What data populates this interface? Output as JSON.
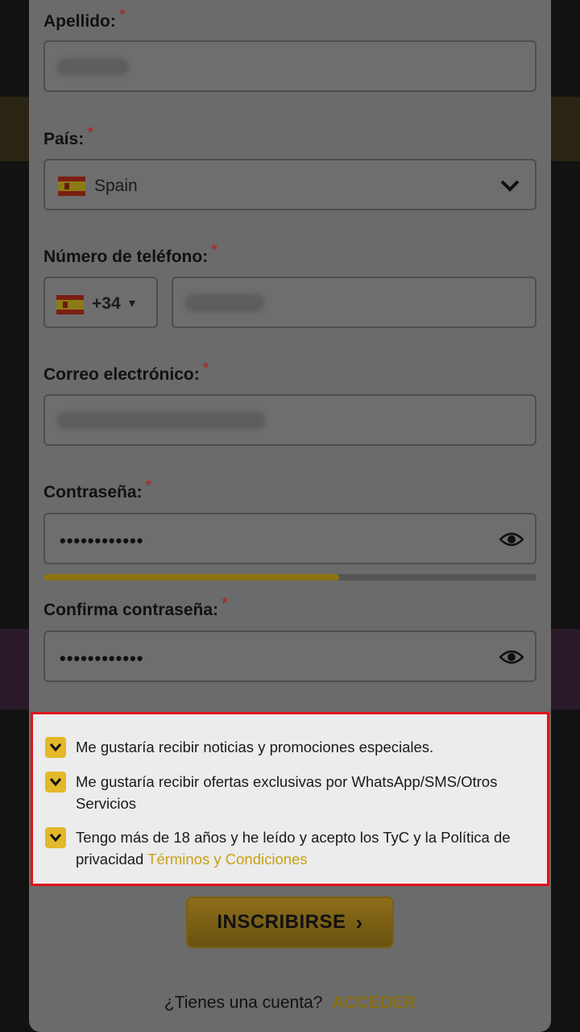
{
  "form": {
    "apellido": {
      "label": "Apellido:",
      "required_mark": "*"
    },
    "pais": {
      "label": "País:",
      "required_mark": "*",
      "value": "Spain",
      "flag_icon": "spain-flag-icon"
    },
    "telefono": {
      "label": "Número de teléfono:",
      "required_mark": "*",
      "prefix": "+34",
      "prefix_caret": "▾"
    },
    "correo": {
      "label": "Correo electrónico:",
      "required_mark": "*"
    },
    "contrasena": {
      "label": "Contraseña:",
      "required_mark": "*",
      "value": "••••••••••••",
      "strength": 0.6
    },
    "confirma": {
      "label": "Confirma contraseña:",
      "required_mark": "*",
      "value": "••••••••••••"
    }
  },
  "consents": [
    {
      "text": "Me gustaría recibir noticias y promociones especiales.",
      "checked": true
    },
    {
      "text": "Me gustaría recibir ofertas exclusivas por WhatsApp/SMS/Otros Servicios",
      "checked": true
    },
    {
      "text": "Tengo más de 18 años y he leído y acepto los TyC y la Política de privacidad",
      "link": "Términos y Condiciones",
      "checked": true
    }
  ],
  "submit": {
    "label": "INSCRIBIRSE",
    "arrow": "›"
  },
  "footer": {
    "question": "¿Tienes una cuenta?",
    "login_label": "ACCEDER"
  },
  "colors": {
    "accent": "#e3b82a",
    "link": "#c9a013",
    "highlight_border": "#e0141b"
  }
}
